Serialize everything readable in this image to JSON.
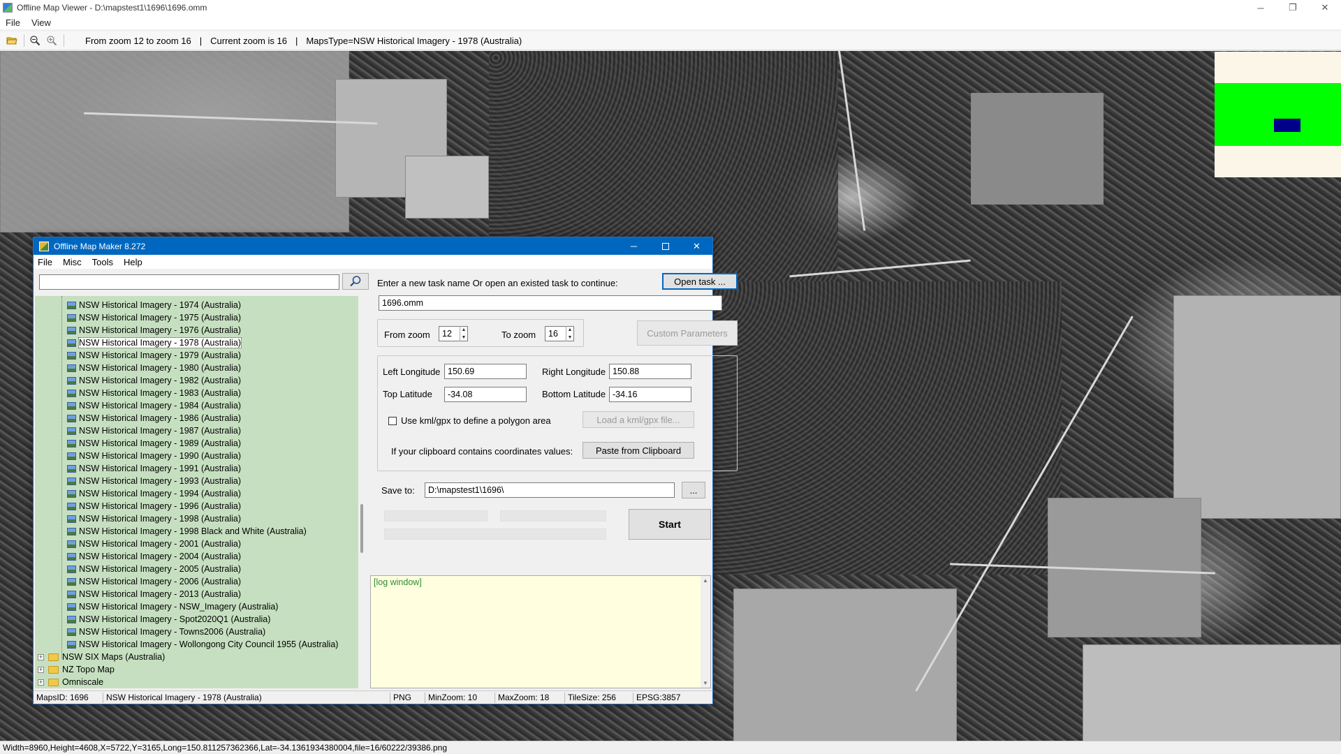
{
  "window": {
    "title": "Offline Map Viewer - D:\\mapstest1\\1696\\1696.omm",
    "controls": {
      "minimize": "─",
      "restore": "❐",
      "close": "✕"
    }
  },
  "menu": {
    "file": "File",
    "view": "View"
  },
  "toolbar": {
    "zoom_range": "From zoom 12 to zoom 16",
    "current_zoom": "Current zoom is 16",
    "maps_type": "MapsType=NSW Historical Imagery - 1978 (Australia)",
    "divider": "|"
  },
  "statusbar": {
    "text": "Width=8960,Height=4608,X=5722,Y=3165,Long=150.811257362366,Lat=-34.1361934380004,file=16/60222/39386.png"
  },
  "dialog": {
    "title": "Offline Map Maker 8.272",
    "menu": {
      "file": "File",
      "misc": "Misc",
      "tools": "Tools",
      "help": "Help"
    },
    "search": {
      "value": ""
    },
    "tree": {
      "items": [
        "NSW Historical Imagery - 1974 (Australia)",
        "NSW Historical Imagery - 1975 (Australia)",
        "NSW Historical Imagery - 1976 (Australia)",
        "NSW Historical Imagery - 1978 (Australia)",
        "NSW Historical Imagery - 1979 (Australia)",
        "NSW Historical Imagery - 1980 (Australia)",
        "NSW Historical Imagery - 1982 (Australia)",
        "NSW Historical Imagery - 1983 (Australia)",
        "NSW Historical Imagery - 1984 (Australia)",
        "NSW Historical Imagery - 1986 (Australia)",
        "NSW Historical Imagery - 1987 (Australia)",
        "NSW Historical Imagery - 1989 (Australia)",
        "NSW Historical Imagery - 1990 (Australia)",
        "NSW Historical Imagery - 1991 (Australia)",
        "NSW Historical Imagery - 1993 (Australia)",
        "NSW Historical Imagery - 1994 (Australia)",
        "NSW Historical Imagery - 1996 (Australia)",
        "NSW Historical Imagery - 1998 (Australia)",
        "NSW Historical Imagery - 1998 Black and White (Australia)",
        "NSW Historical Imagery - 2001 (Australia)",
        "NSW Historical Imagery - 2004 (Australia)",
        "NSW Historical Imagery - 2005 (Australia)",
        "NSW Historical Imagery - 2006 (Australia)",
        "NSW Historical Imagery - 2013 (Australia)",
        "NSW Historical Imagery - NSW_Imagery (Australia)",
        "NSW Historical Imagery - Spot2020Q1 (Australia)",
        "NSW Historical Imagery - Towns2006 (Australia)",
        "NSW Historical Imagery - Wollongong City Council 1955 (Australia)"
      ],
      "selected_index": 3,
      "groups": [
        "NSW SIX Maps (Australia)",
        "NZ Topo Map",
        "Omniscale"
      ],
      "expander_symbol": "+"
    },
    "task_prompt": "Enter a new task name Or open an existed task to continue:",
    "open_task_label": "Open task ...",
    "task_name": "1696.omm",
    "from_zoom_label": "From zoom",
    "from_zoom_value": "12",
    "to_zoom_label": "To zoom",
    "to_zoom_value": "16",
    "custom_params_label": "Custom Parameters",
    "left_lon_label": "Left Longitude",
    "left_lon_value": "150.69",
    "right_lon_label": "Right Longitude",
    "right_lon_value": "150.88",
    "top_lat_label": "Top Latitude",
    "top_lat_value": "-34.08",
    "bottom_lat_label": "Bottom Latitude",
    "bottom_lat_value": "-34.16",
    "kml_label": "Use kml/gpx to define a polygon area",
    "kml_checked": false,
    "load_kml_label": "Load a kml/gpx file...",
    "clipboard_prompt": "If your clipboard contains coordinates values:",
    "paste_label": "Paste from Clipboard",
    "save_to_label": "Save to:",
    "save_to_value": "D:\\mapstest1\\1696\\",
    "browse_label": "...",
    "start_label": "Start",
    "log_text": "[log window]",
    "status": {
      "maps_id": "MapsID: 1696",
      "maps_name": "NSW Historical Imagery - 1978 (Australia)",
      "format": "PNG",
      "min_zoom": "MinZoom: 10",
      "max_zoom": "MaxZoom: 18",
      "tile_size": "TileSize: 256",
      "epsg": "EPSG:3857"
    }
  },
  "colors": {
    "tree_bg": "#c6dfc0",
    "dialog_title": "#0067c0",
    "log_bg": "#ffffe0",
    "log_text": "#2e8b2e",
    "overview_bg": "#fbf6e8",
    "overview_area": "#00ff00",
    "overview_viewport": "#00008b"
  }
}
